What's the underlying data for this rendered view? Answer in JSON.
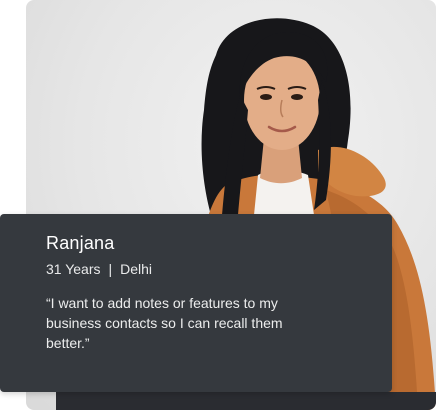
{
  "persona": {
    "name": "Ranjana",
    "age": "31 Years",
    "separator": "|",
    "location": "Delhi",
    "quote": "“I want to add notes or features to my business contacts so I can recall them better.”"
  },
  "photo": {
    "subject": "portrait-of-young-woman"
  },
  "colors": {
    "card_background": "#35393e",
    "text_primary": "#ffffff",
    "photo_background": "#e6e6e6",
    "jacket": "#c9783a"
  }
}
